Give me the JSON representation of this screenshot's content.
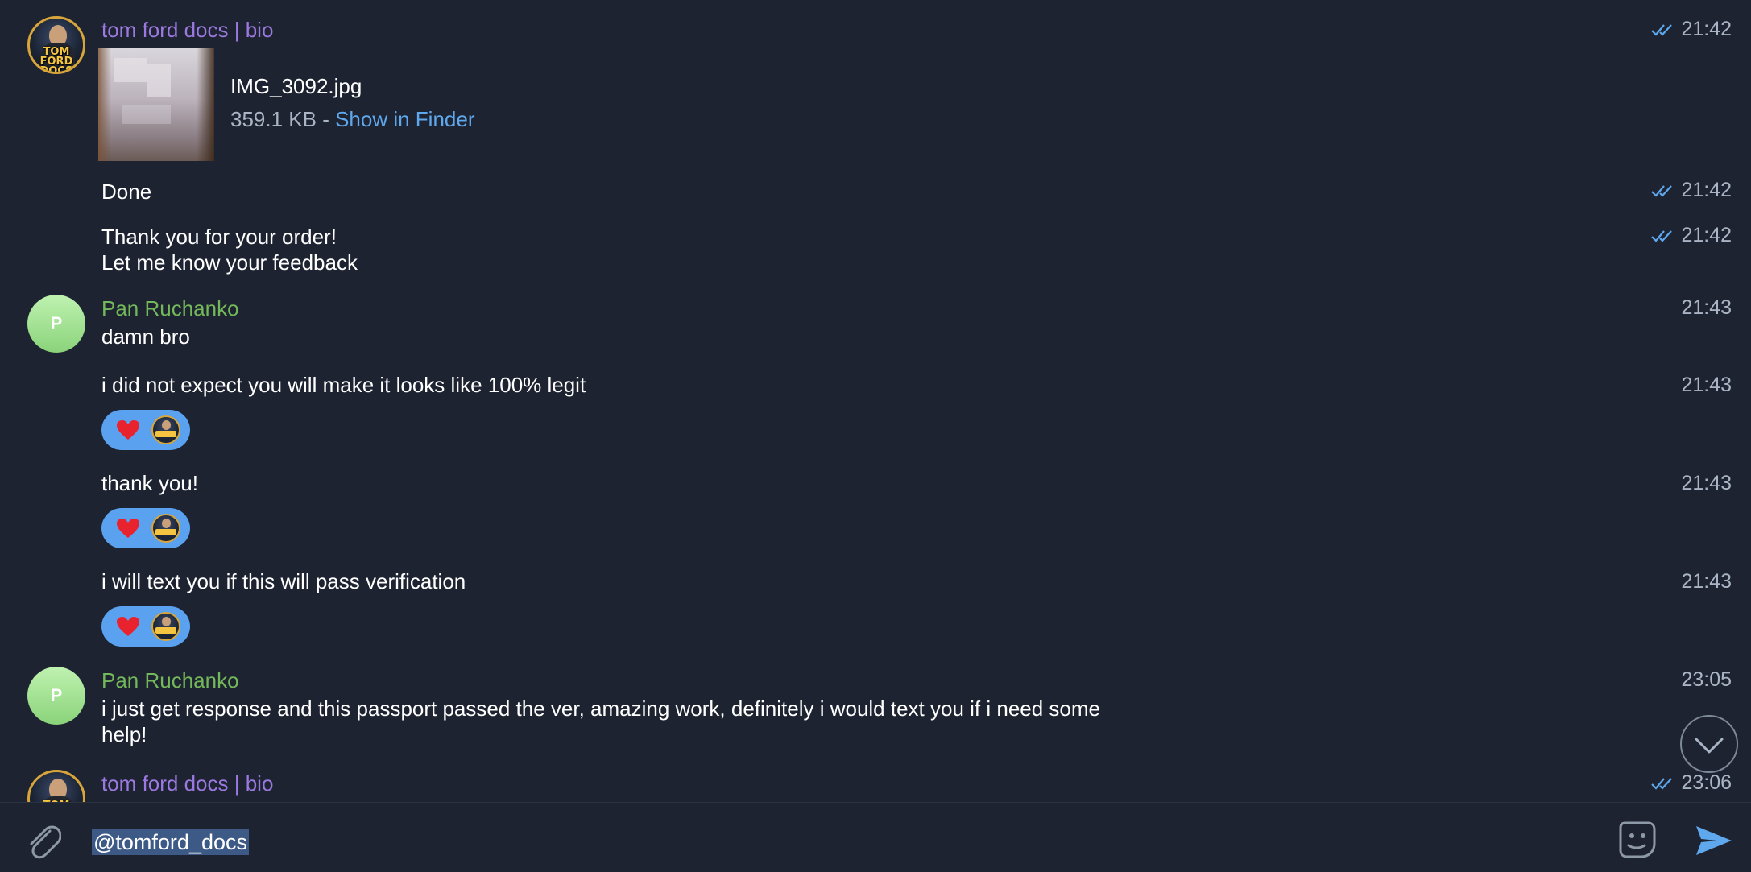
{
  "messages": {
    "m1": {
      "sender": "tom ford docs | bio",
      "time": "21:42",
      "file_name": "IMG_3092.jpg",
      "file_size": "359.1 KB - ",
      "file_action": "Show in Finder"
    },
    "m2": {
      "text": "Done",
      "time": "21:42"
    },
    "m3": {
      "line1": "Thank you for your order!",
      "line2": "Let me know your feedback",
      "time": "21:42"
    },
    "m4": {
      "sender": "Pan Ruchanko",
      "avatar_letter": "P",
      "text": "damn bro",
      "time": "21:43"
    },
    "m5": {
      "text": "i did not expect you will make it looks like 100% legit",
      "time": "21:43"
    },
    "m6": {
      "text": "thank you!",
      "time": "21:43"
    },
    "m7": {
      "text": "i will text you if this will pass verification",
      "time": "21:43"
    },
    "m8": {
      "sender": "Pan Ruchanko",
      "avatar_letter": "P",
      "line1": "i just get response and this passport passed the ver, amazing work, definitely i would text you if i need some",
      "line2": "help!",
      "time": "23:05"
    },
    "m9": {
      "sender": "tom ford docs | bio",
      "time": "23:06"
    }
  },
  "avatar_text": {
    "line1": "TOM FORD",
    "line2": "DOCS"
  },
  "input": {
    "value": "@tomford_docs"
  },
  "icons": {
    "read": "double-check-icon",
    "attach": "paperclip-icon",
    "sticker": "sticker-icon",
    "send": "send-icon",
    "scroll": "chevron-down-icon",
    "reaction": "heart-icon"
  },
  "colors": {
    "background": "#1d2330",
    "tf_name": "#9b79e0",
    "pan_name": "#73b85a",
    "link": "#5fa8ee",
    "reaction": "#5aa2f0",
    "timestamp": "#a9b4c4"
  }
}
